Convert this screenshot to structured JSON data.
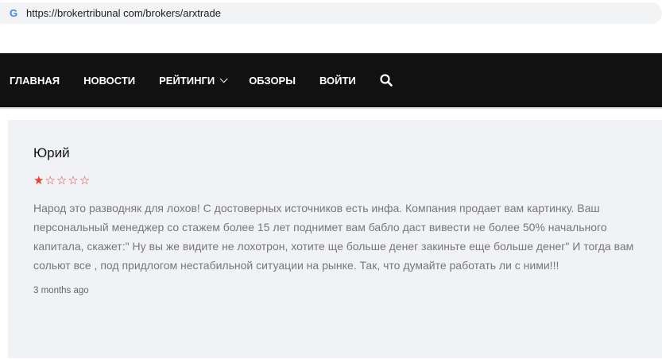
{
  "browser": {
    "url": "https://brokertribunal com/brokers/arxtrade",
    "icon": "google-g-icon"
  },
  "nav": {
    "items": [
      "ГЛАВНАЯ",
      "НОВОСТИ",
      "РЕЙТИНГИ",
      "ОБЗОРЫ",
      "ВОЙТИ"
    ]
  },
  "review": {
    "author": "Юрий",
    "rating": 1,
    "max_rating": 5,
    "star_color": "#e8402f",
    "text": "Народ это разводняк для лохов! С достоверных источников есть инфа. Компания продает вам картинку. Ваш персональный менеджер со стажем более 15 лет поднимет вам бабло даст вивести не более 50% начального капитала, скажет:\" Ну вы же видите не лохотрон, хотите ще больше денег закиньте еще больше денег\" И тогда вам сольют все , под придлогом нестабильной ситуации на рынке. Так, что думайте работать ли с ними!!!",
    "time": "3 months ago"
  }
}
